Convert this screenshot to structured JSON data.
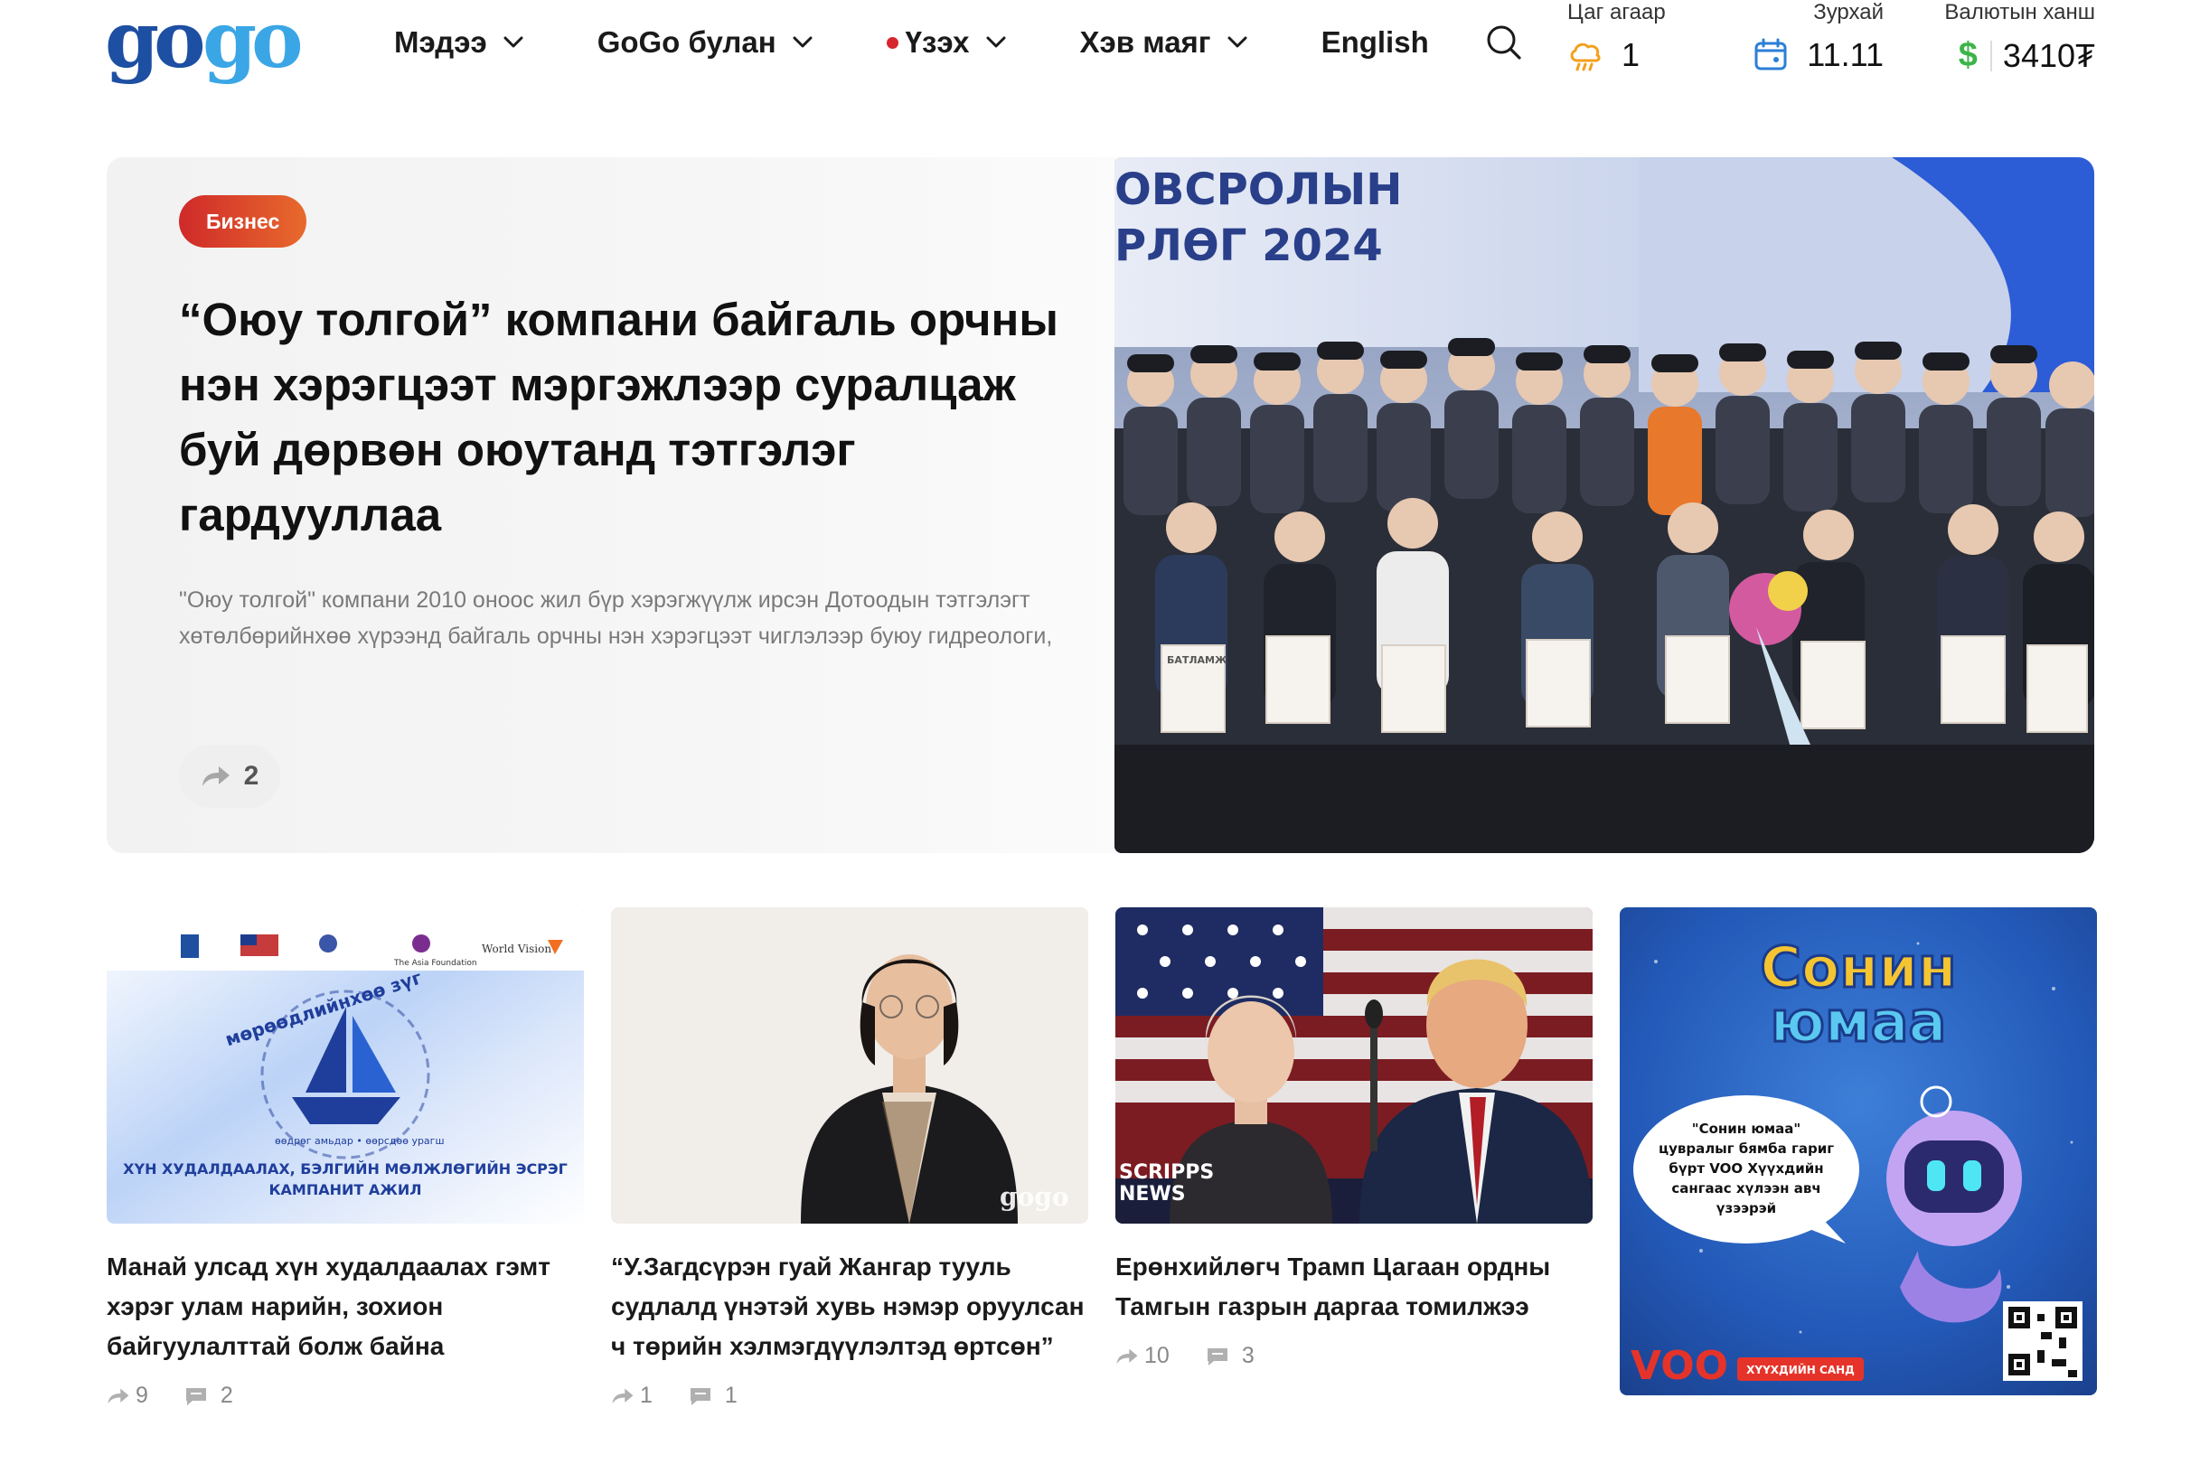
{
  "site": {
    "logo_text": "gogo"
  },
  "nav": {
    "items": [
      {
        "label": "Мэдээ"
      },
      {
        "label": "GoGo булан"
      },
      {
        "label": "Үзэх"
      },
      {
        "label": "Хэв маяг"
      }
    ],
    "language": "English"
  },
  "widgets": {
    "weather": {
      "label": "Цаг агаар",
      "value": "1"
    },
    "date": {
      "label": "Зурхай",
      "value": "11.11"
    },
    "currency": {
      "label": "Валютын ханш",
      "symbol": "$",
      "value": "3410₮"
    }
  },
  "hero": {
    "category": "Бизнес",
    "title": "“Оюу толгой” компани байгаль орчны нэн хэрэгцээт мэргэжлээр суралцаж буй дөрвөн оюутанд тэтгэлэг гардууллаа",
    "excerpt": "\"Оюу толгой\" компани 2010 оноос жил бүр хэрэгжүүлж ирсэн Дотоодын тэтгэлэгт хөтөлбөрийнхөө хүрээнд байгаль орчны нэн хэрэгцээт чиглэлээр буюу гидреологи,",
    "shares": "2",
    "image": {
      "banner_line1": "ОВСРОЛЫН",
      "banner_line2": "РЛӨГ 2024",
      "certificate_label": "БАТЛАМЖ"
    }
  },
  "cards": [
    {
      "title": "Манай улсад хүн худалдаалах гэмт хэрэг улам нарийн, зохион байгуулалттай болж байна",
      "shares": "9",
      "comments": "2",
      "image": {
        "logo_asia": "The Asia Foundation",
        "logo_wv": "World Vision",
        "arc_text": "мөрөөдлийнхөө зүг",
        "slogan": "өөдрөг амьдар • өөрсдөө урагш",
        "caption_line1": "ХҮН ХУДАЛДААЛАХ, БЭЛГИЙН МӨЛЖЛӨГИЙН ЭСРЭГ",
        "caption_line2": "КАМПАНИТ АЖИЛ"
      }
    },
    {
      "title": "“У.Загдсүрэн гуай Жангар тууль судлалд үнэтэй хувь нэмэр оруулсан ч төрийн хэлмэгдүүлэлтэд өртсөн”",
      "shares": "1",
      "comments": "1",
      "image": {
        "watermark": "gogo"
      }
    },
    {
      "title": "Ерөнхийлөгч Трамп Цагаан ордны Тамгын газрын даргаа томилжээ",
      "shares": "10",
      "comments": "3",
      "image": {
        "watermark_line1": "SCRIPPS",
        "watermark_line2": "NEWS"
      }
    }
  ],
  "ad": {
    "title_line1": "Сонин",
    "title_line2": "юмаа",
    "bubble_line1": "\"Сонин юмаа\"",
    "bubble_line2": "цувралыг бямба гариг",
    "bubble_line3": "бүрт VOO Хүүхдийн",
    "bubble_line4": "сангаас хүлээн авч",
    "bubble_line5": "үзээрэй",
    "brand": "VOO",
    "fund_label": "ХҮҮХДИЙН САНД"
  },
  "colors": {
    "brand_dark": "#1d4fa3",
    "brand_light": "#3aa6e6",
    "badge_start": "#cf2a2a",
    "badge_end": "#e86a2c",
    "currency": "#3cb44a",
    "weather_icon": "#f4a01c",
    "date_icon": "#2b7fd6",
    "live_dot": "#d7262f"
  }
}
